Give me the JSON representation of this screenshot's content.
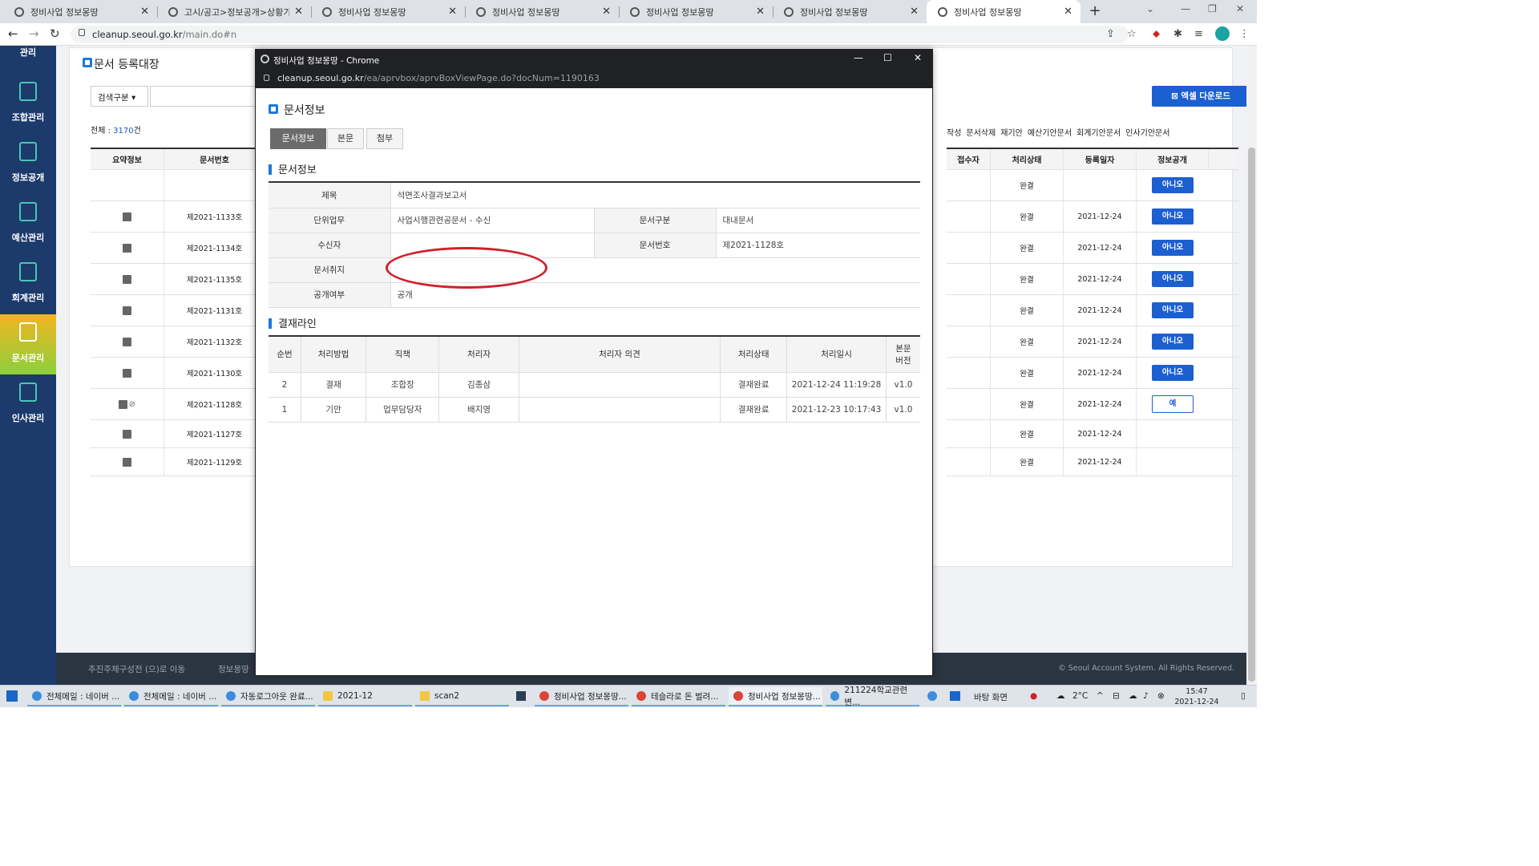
{
  "browser": {
    "tabs": [
      {
        "title": "정비사업 정보몽땅"
      },
      {
        "title": "고시/공고>정보공개>상황가락"
      },
      {
        "title": "정비사업 정보몽땅"
      },
      {
        "title": "정비사업 정보몽땅"
      },
      {
        "title": "정비사업 정보몽땅"
      },
      {
        "title": "정비사업 정보몽땅"
      },
      {
        "title": "정비사업 정보몽땅"
      }
    ],
    "active_tab_index": 6,
    "url_host": "cleanup.seoul.go.kr",
    "url_path": "/main.do#n",
    "new_tab": "+",
    "close_glyph": "✕"
  },
  "sidenav": {
    "top_partial": "관리",
    "items": [
      {
        "label": "조합관리",
        "icon": "list-doc-icon"
      },
      {
        "label": "정보공개",
        "icon": "search-doc-icon"
      },
      {
        "label": "예산관리",
        "icon": "budget-doc-icon"
      },
      {
        "label": "회계관리",
        "icon": "won-cycle-icon"
      },
      {
        "label": "문서관리",
        "icon": "folder-icon"
      },
      {
        "label": "인사관리",
        "icon": "people-icon"
      }
    ],
    "active_index": 4,
    "accent_color": "#49c6b5"
  },
  "bgpage": {
    "title": "문서 등록대장",
    "search_select": "검색구분 ▾",
    "total_label": "전체 : ",
    "total_value": "3170",
    "total_suffix": "건",
    "excel_button": "엑셀 다운로드",
    "actions": [
      "작성",
      "문서삭제",
      "재기안",
      "예산기안문서",
      "회계기안문서",
      "인사기안문서"
    ],
    "left_headers": [
      "요약정보",
      "문서번호"
    ],
    "right_headers": [
      "접수자",
      "처리상태",
      "등록일자",
      "정보공개"
    ],
    "rows": [
      {
        "doc_no": "",
        "status": "완결",
        "date": "",
        "public": "아니오",
        "clip": false,
        "icon": false
      },
      {
        "doc_no": "제2021-1133호",
        "status": "완결",
        "date": "2021-12-24",
        "public": "아니오",
        "clip": false,
        "icon": true
      },
      {
        "doc_no": "제2021-1134호",
        "status": "완결",
        "date": "2021-12-24",
        "public": "아니오",
        "clip": false,
        "icon": true
      },
      {
        "doc_no": "제2021-1135호",
        "status": "완결",
        "date": "2021-12-24",
        "public": "아니오",
        "clip": false,
        "icon": true
      },
      {
        "doc_no": "제2021-1131호",
        "status": "완결",
        "date": "2021-12-24",
        "public": "아니오",
        "clip": false,
        "icon": true
      },
      {
        "doc_no": "제2021-1132호",
        "status": "완결",
        "date": "2021-12-24",
        "public": "아니오",
        "clip": false,
        "icon": true
      },
      {
        "doc_no": "제2021-1130호",
        "status": "완결",
        "date": "2021-12-24",
        "public": "아니오",
        "clip": false,
        "icon": true
      },
      {
        "doc_no": "제2021-1128호",
        "status": "완결",
        "date": "2021-12-24",
        "public": "예",
        "clip": true,
        "icon": true
      },
      {
        "doc_no": "제2021-1127호",
        "status": "완결",
        "date": "2021-12-24",
        "public": "",
        "clip": false,
        "icon": true
      },
      {
        "doc_no": "제2021-1129호",
        "status": "완결",
        "date": "2021-12-24",
        "public": "",
        "clip": false,
        "icon": true
      }
    ],
    "footer_link1": "추진주체구성전 (으)로 이동",
    "footer_link2": "정보몽땅",
    "copyright": "© Seoul Account System. All Rights Reserved."
  },
  "popup": {
    "window_title": "정비사업 정보몽땅 - Chrome",
    "url_host": "cleanup.seoul.go.kr",
    "url_path": "/ea/aprvbox/aprvBoxViewPage.do?docNum=1190163",
    "page_title": "문서정보",
    "tabs": [
      "문서정보",
      "본문",
      "첨부"
    ],
    "active_tab": 0,
    "section1_title": "문서정보",
    "info": {
      "title_label": "제목",
      "title_value": "석면조사결과보고서",
      "unit_label": "단위업무",
      "unit_value": "사업시행관련공문서 - 수신",
      "category_label": "문서구분",
      "category_value": "대내문서",
      "recipient_label": "수신자",
      "recipient_value": "",
      "docno_label": "문서번호",
      "docno_value": "제2021-1128호",
      "purpose_label": "문서취지",
      "purpose_value": "",
      "public_label": "공개여부",
      "public_value": "공개"
    },
    "section2_title": "결재라인",
    "approval_headers": [
      "순번",
      "처리방법",
      "직책",
      "처리자",
      "처리자 의견",
      "처리상태",
      "처리일시",
      "본문\n버전"
    ],
    "approval_rows": [
      [
        "2",
        "결재",
        "조합장",
        "김종삼",
        "",
        "결재완료",
        "2021-12-24 11:19:28",
        "v1.0"
      ],
      [
        "1",
        "기안",
        "업무담당자",
        "배지영",
        "",
        "결재완료",
        "2021-12-23 10:17:43",
        "v1.0"
      ]
    ],
    "annotation_color": "#d0212a"
  },
  "taskbar": {
    "items": [
      {
        "label": "전체메일 : 네이버 ...",
        "icon": "edge-icon"
      },
      {
        "label": "전체메일 : 네이버 ...",
        "icon": "edge-icon"
      },
      {
        "label": "자동로그아웃 완료...",
        "icon": "edge-icon"
      },
      {
        "label": "2021-12",
        "icon": "folder-icon"
      },
      {
        "label": "scan2",
        "icon": "folder-icon"
      },
      {
        "label": "정비사업 정보몽땅...",
        "icon": "chrome-icon"
      },
      {
        "label": "테슬라로 돈 벌려...",
        "icon": "chrome-icon"
      },
      {
        "label": "정비사업 정보몽땅...",
        "icon": "chrome-icon"
      },
      {
        "label": "211224학교관련변...",
        "icon": "app-icon"
      }
    ],
    "desktop_label": "바탕 화면",
    "temperature": "2°C",
    "time": "15:47",
    "date": "2021-12-24"
  }
}
